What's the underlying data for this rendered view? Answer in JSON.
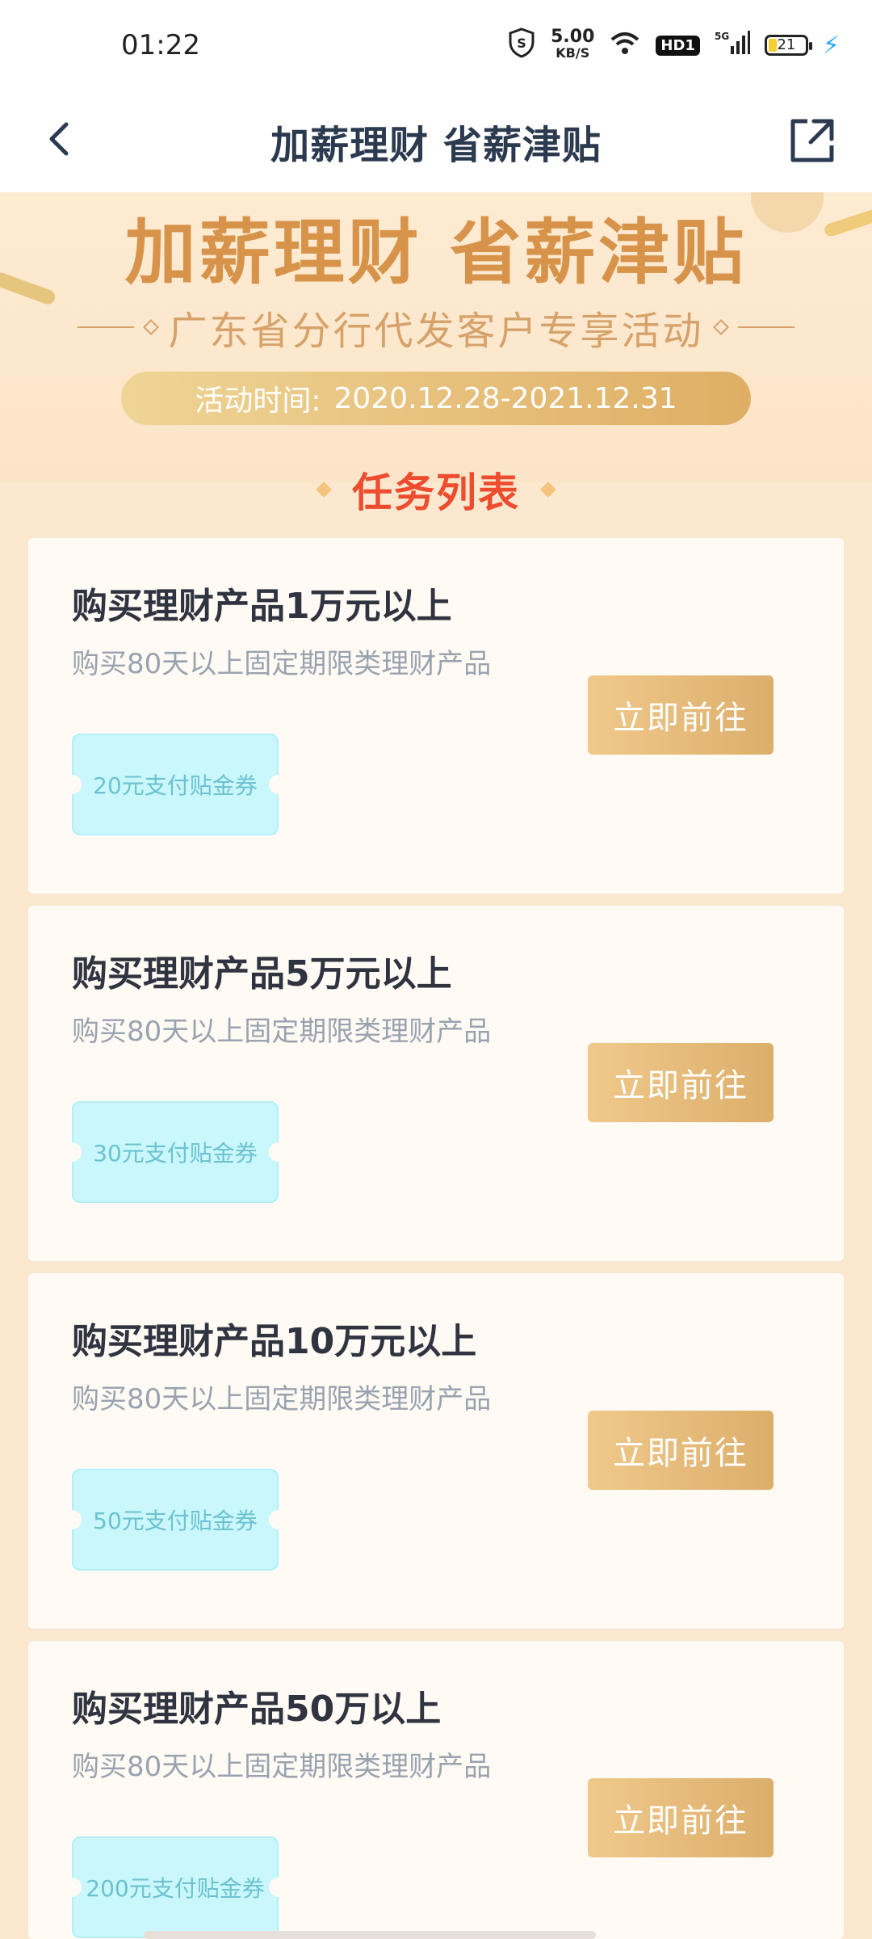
{
  "status": {
    "time": "01:22",
    "speed_value": "5.00",
    "speed_unit": "KB/S",
    "hd_badge": "HD1",
    "network": "5G",
    "battery": "21"
  },
  "navbar": {
    "title": "加薪理财 省薪津贴"
  },
  "hero": {
    "title": "加薪理财 省薪津贴",
    "subtitle": "广东省分行代发客户专享活动",
    "period_label": "活动时间:",
    "period_value": "2020.12.28-2021.12.31"
  },
  "tasks": {
    "section_title": "任务列表",
    "items": [
      {
        "title": "购买理财产品1万元以上",
        "desc": "购买80天以上固定期限类理财产品",
        "coupon": "20元支付贴金券",
        "button": "立即前往"
      },
      {
        "title": "购买理财产品5万元以上",
        "desc": "购买80天以上固定期限类理财产品",
        "coupon": "30元支付贴金券",
        "button": "立即前往"
      },
      {
        "title": "购买理财产品10万元以上",
        "desc": "购买80天以上固定期限类理财产品",
        "coupon": "50元支付贴金券",
        "button": "立即前往"
      },
      {
        "title": "购买理财产品50万以上",
        "desc": "购买80天以上固定期限类理财产品",
        "coupon": "200元支付贴金券",
        "button": "立即前往"
      }
    ]
  },
  "colors": {
    "accent_gold": "#dcae6b",
    "title_red": "#ee4c2e",
    "coupon_cyan": "#c9f7fb"
  },
  "icons": [
    "shield-s-icon",
    "wifi-icon",
    "signal-icon",
    "battery-icon",
    "charging-bolt-icon",
    "back-chevron-icon",
    "share-icon"
  ]
}
